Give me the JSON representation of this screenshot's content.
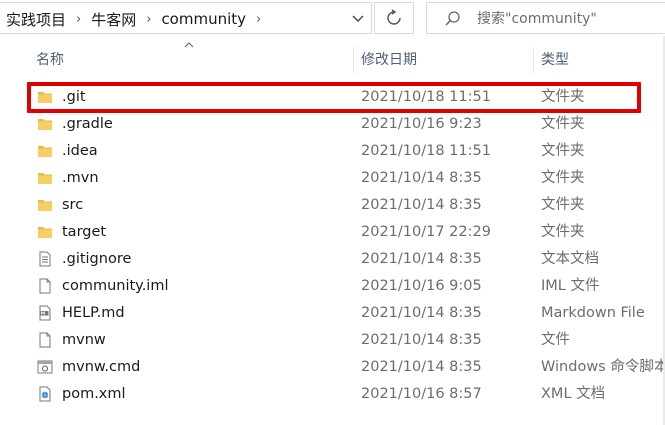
{
  "breadcrumb": {
    "items": [
      "实践项目",
      "牛客网",
      "community"
    ],
    "separator": "›"
  },
  "search": {
    "placeholder": "搜索\"community\""
  },
  "columns": {
    "name": "名称",
    "date": "修改日期",
    "type": "类型"
  },
  "colors": {
    "highlight": "#e00000",
    "folder": "#e8b84a",
    "muted_text": "#6d6d6d"
  },
  "files": [
    {
      "name": ".git",
      "date": "2021/10/18 11:51",
      "type": "文件夹",
      "icon": "folder-icon"
    },
    {
      "name": ".gradle",
      "date": "2021/10/16 9:23",
      "type": "文件夹",
      "icon": "folder-icon"
    },
    {
      "name": ".idea",
      "date": "2021/10/18 11:51",
      "type": "文件夹",
      "icon": "folder-icon"
    },
    {
      "name": ".mvn",
      "date": "2021/10/14 8:35",
      "type": "文件夹",
      "icon": "folder-icon"
    },
    {
      "name": "src",
      "date": "2021/10/14 8:35",
      "type": "文件夹",
      "icon": "folder-icon"
    },
    {
      "name": "target",
      "date": "2021/10/17 22:29",
      "type": "文件夹",
      "icon": "folder-icon"
    },
    {
      "name": ".gitignore",
      "date": "2021/10/14 8:35",
      "type": "文本文档",
      "icon": "text-file-icon"
    },
    {
      "name": "community.iml",
      "date": "2021/10/16 9:05",
      "type": "IML 文件",
      "icon": "file-icon"
    },
    {
      "name": "HELP.md",
      "date": "2021/10/14 8:35",
      "type": "Markdown File",
      "icon": "markdown-file-icon"
    },
    {
      "name": "mvnw",
      "date": "2021/10/14 8:35",
      "type": "文件",
      "icon": "file-icon"
    },
    {
      "name": "mvnw.cmd",
      "date": "2021/10/14 8:35",
      "type": "Windows 命令脚本",
      "icon": "cmd-file-icon"
    },
    {
      "name": "pom.xml",
      "date": "2021/10/16 8:57",
      "type": "XML 文档",
      "icon": "xml-file-icon"
    }
  ]
}
